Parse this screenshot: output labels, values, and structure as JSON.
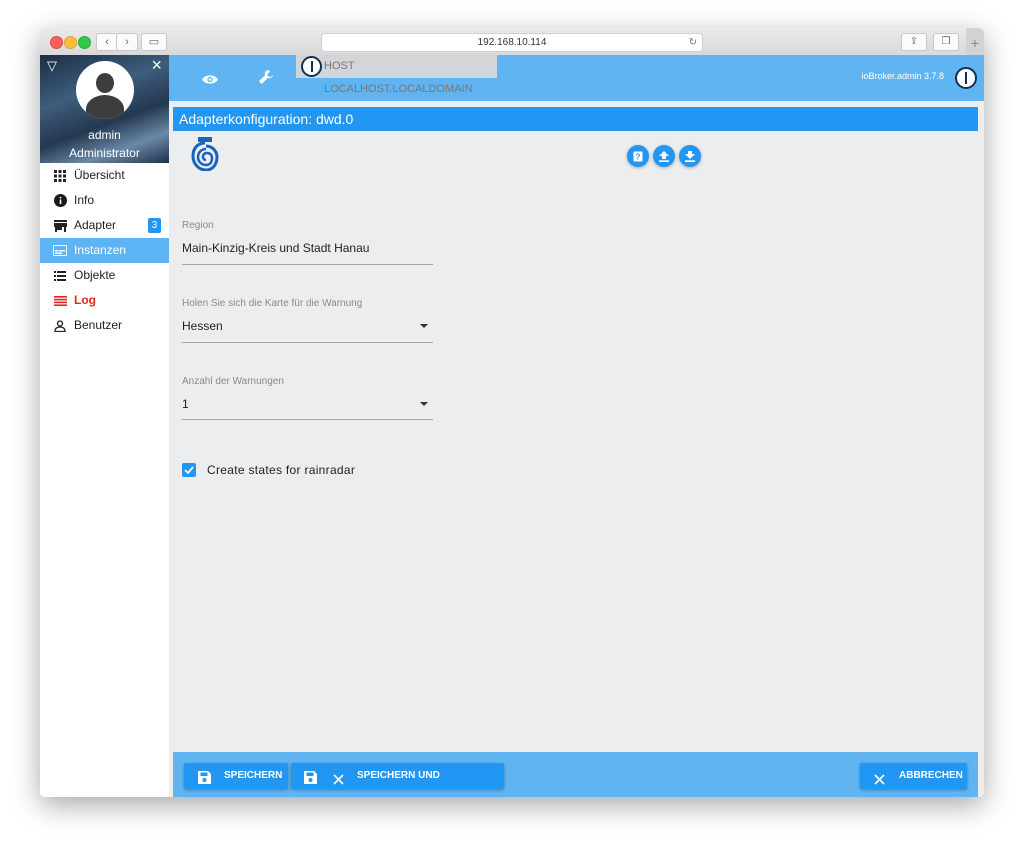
{
  "browser": {
    "url": "192.168.10.114"
  },
  "sidebar": {
    "user_name": "admin",
    "user_role": "Administrator",
    "items": [
      {
        "label": "Übersicht",
        "icon": "apps-grid-icon"
      },
      {
        "label": "Info",
        "icon": "info-icon"
      },
      {
        "label": "Adapter",
        "icon": "store-icon",
        "badge": "3"
      },
      {
        "label": "Instanzen",
        "icon": "instances-icon",
        "active": true
      },
      {
        "label": "Objekte",
        "icon": "list-icon"
      },
      {
        "label": "Log",
        "icon": "log-lines-icon",
        "color": "#e3261c"
      },
      {
        "label": "Benutzer",
        "icon": "user-icon"
      }
    ]
  },
  "topbar": {
    "host_label": "HOST LOCALHOST.LOCALDOMAIN",
    "version": "ioBroker.admin 3.7.8"
  },
  "config": {
    "title": "Adapterkonfiguration: dwd.0",
    "region_label": "Region",
    "region_value": "Main-Kinzig-Kreis und Stadt Hanau",
    "map_label": "Holen Sie sich die Karte für die Warnung",
    "map_value": "Hessen",
    "count_label": "Anzahl der Warnungen",
    "count_value": "1",
    "rainradar_label": "Create states for rainradar",
    "rainradar_checked": true
  },
  "footer": {
    "save_label": "SPEICHERN",
    "save_close_label": "SPEICHERN UND SCHLIESSEN",
    "cancel_label": "ABBRECHEN"
  },
  "colors": {
    "accent": "#2196f3",
    "topbar": "#61b4f2",
    "active_menu": "#5db4f5",
    "log_red": "#e3261c"
  }
}
